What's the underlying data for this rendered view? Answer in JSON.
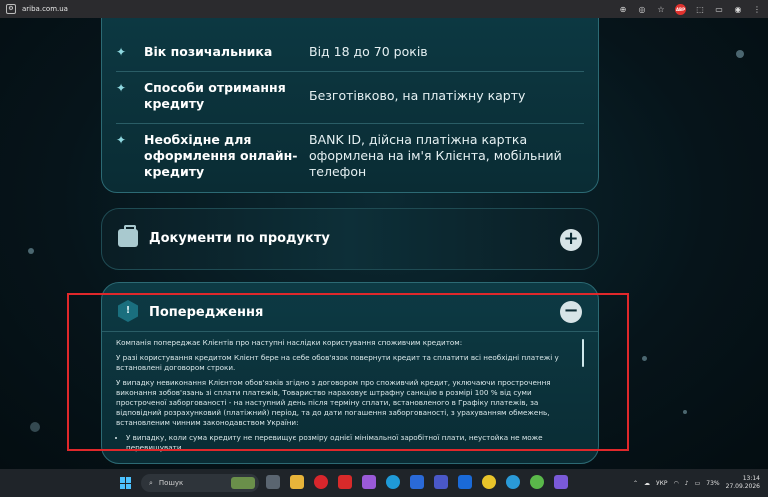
{
  "browser": {
    "url": "ariba.com.ua",
    "ext_badge": "ABP"
  },
  "details": {
    "rows": [
      {
        "label": "Вік позичальника",
        "value": "Від 18 до 70 років"
      },
      {
        "label": "Способи отримання кредиту",
        "value": "Безготівково, на платіжну карту"
      },
      {
        "label": "Необхідне для оформлення онлайн-кредиту",
        "value": "BANK ID, дійсна платіжна картка оформлена на ім'я Клієнта, мобільний телефон"
      }
    ]
  },
  "documents": {
    "title": "Документи по продукту",
    "toggle": "+"
  },
  "warnings": {
    "title": "Попередження",
    "toggle": "−",
    "paragraphs": [
      "Компанія попереджає Клієнтів про наступні наслідки користування споживчим кредитом:",
      "У разі користування кредитом Клієнт бере на себе обов'язок повернути кредит та сплатити всі необхідні платежі у встановлені договором строки.",
      "У випадку невиконання Клієнтом обов'язків згідно з договором про споживчий кредит, уключаючи прострочення виконання зобов'язань зі сплати платежів, Товариство нараховує штрафну санкцію в розмірі 100 % від суми простроченої заборгованості - на наступний день після терміну сплати, встановленого в Графіку платежів, за відповідний розрахунковий (платіжний) період, та до дати погашення заборгованості, з урахуванням обмежень, встановленим чинним законодавством України:"
    ],
    "bullet": "У випадку, коли сума кредиту не перевищує розміру однієї мінімальної заробітної плати, неустойка не може перевищувати"
  },
  "taskbar": {
    "search_placeholder": "Пошук",
    "language": "УКР",
    "battery": "73%",
    "time": "13:14",
    "date": "27.09.2026"
  }
}
